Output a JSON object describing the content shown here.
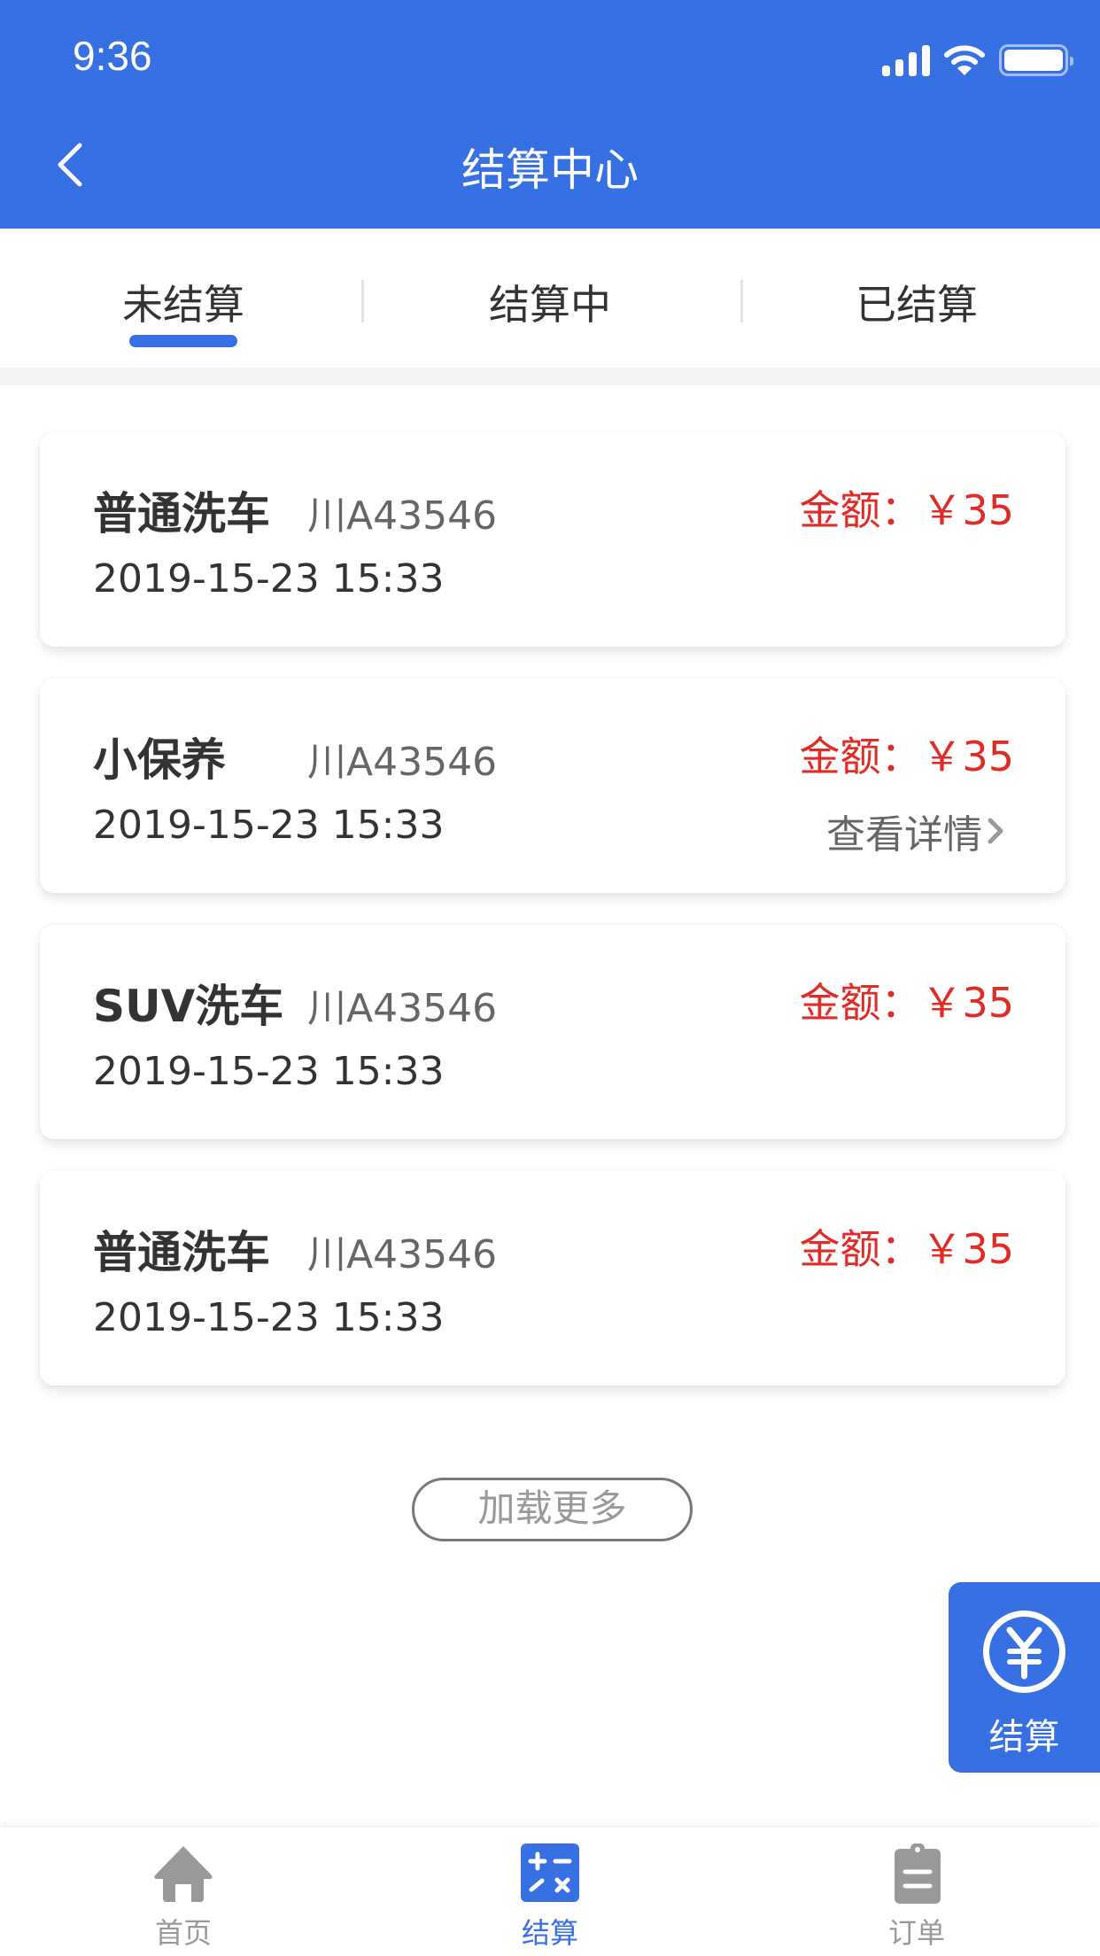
{
  "status_bar": {
    "time": "9:36",
    "signal_icon": "signal-icon",
    "wifi_icon": "wifi-icon",
    "battery_icon": "battery-icon"
  },
  "nav": {
    "back_icon": "chevron-left-icon",
    "title": "结算中心"
  },
  "tabs": [
    {
      "label": "未结算",
      "active": true
    },
    {
      "label": "结算中",
      "active": false
    },
    {
      "label": "已结算",
      "active": false
    }
  ],
  "orders": [
    {
      "service": "普通洗车",
      "plate": "川A43546",
      "date": "2019-15-23 15:33",
      "amount": "金额：￥35",
      "detail": ""
    },
    {
      "service": "小保养",
      "plate": "川A43546",
      "date": "2019-15-23 15:33",
      "amount": "金额：￥35",
      "detail": "查看详情"
    },
    {
      "service": "SUV洗车",
      "plate": "川A43546",
      "date": "2019-15-23 15:33",
      "amount": "金额：￥35",
      "detail": ""
    },
    {
      "service": "普通洗车",
      "plate": "川A43546",
      "date": "2019-15-23 15:33",
      "amount": "金额：￥35",
      "detail": ""
    }
  ],
  "load_more": "加载更多",
  "float_button": {
    "icon": "yen-circle-icon",
    "label": "结算"
  },
  "bottom_nav": [
    {
      "label": "首页",
      "icon": "home-icon",
      "active": false
    },
    {
      "label": "结算",
      "icon": "calculator-icon",
      "active": true
    },
    {
      "label": "订单",
      "icon": "clipboard-icon",
      "active": false
    }
  ],
  "colors": {
    "primary": "#3670E2",
    "amount_red": "#E02B27",
    "inactive_gray": "#999999"
  }
}
